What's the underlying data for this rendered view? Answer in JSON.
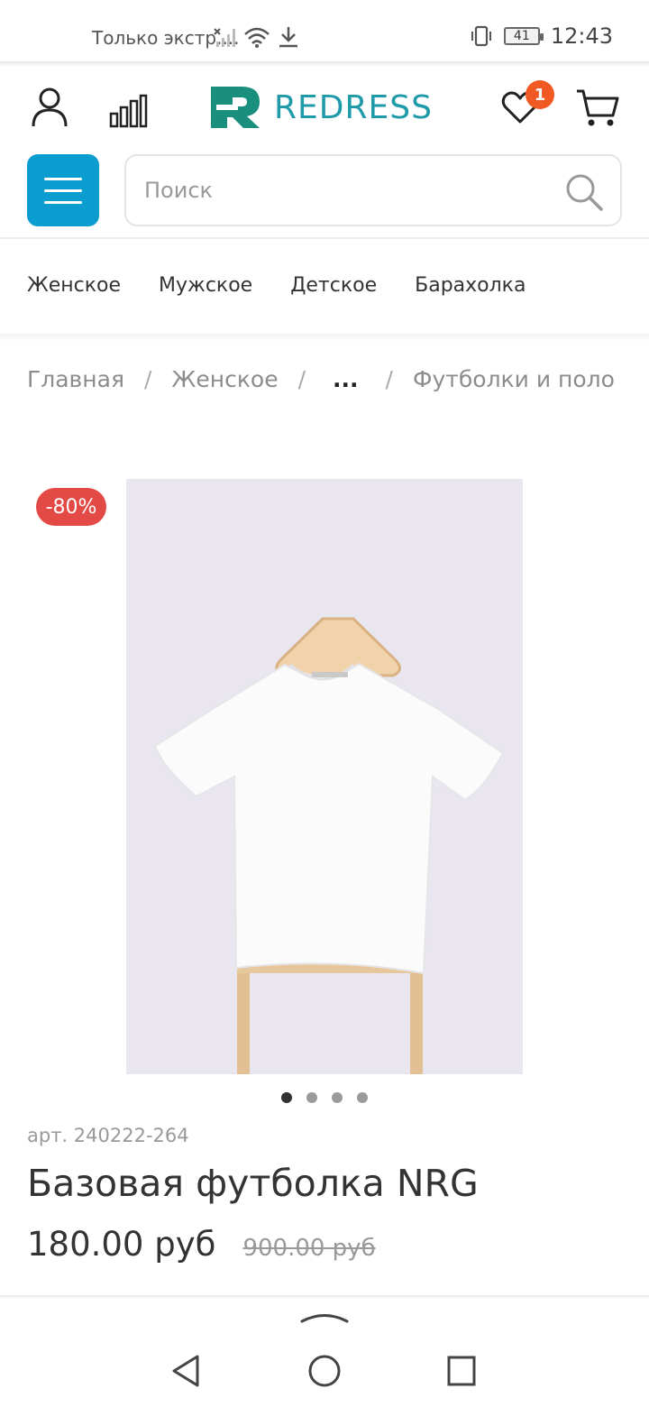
{
  "status_bar": {
    "notification": "Только экстр....",
    "time": "12:43",
    "battery": "41"
  },
  "header": {
    "logo_text": "REDRESS",
    "wishlist_count": "1",
    "brand_color": "#1f9aa8",
    "badge_color": "#f05a22"
  },
  "search": {
    "placeholder": "Поиск",
    "value": ""
  },
  "categories": [
    "Женское",
    "Мужское",
    "Детское",
    "Барахолка"
  ],
  "breadcrumbs": {
    "home": "Главная",
    "section": "Женское",
    "collapsed": "...",
    "current": "Футболки и поло",
    "separator": "/"
  },
  "product": {
    "discount": "-80%",
    "sku": "арт. 240222-264",
    "title": "Базовая футболка NRG",
    "price": "180.00 руб",
    "old_price": "900.00 руб",
    "gallery_total": 4,
    "gallery_active": 1
  },
  "colors": {
    "menu_button": "#0c9dd0",
    "discount_badge": "#e44a45"
  }
}
